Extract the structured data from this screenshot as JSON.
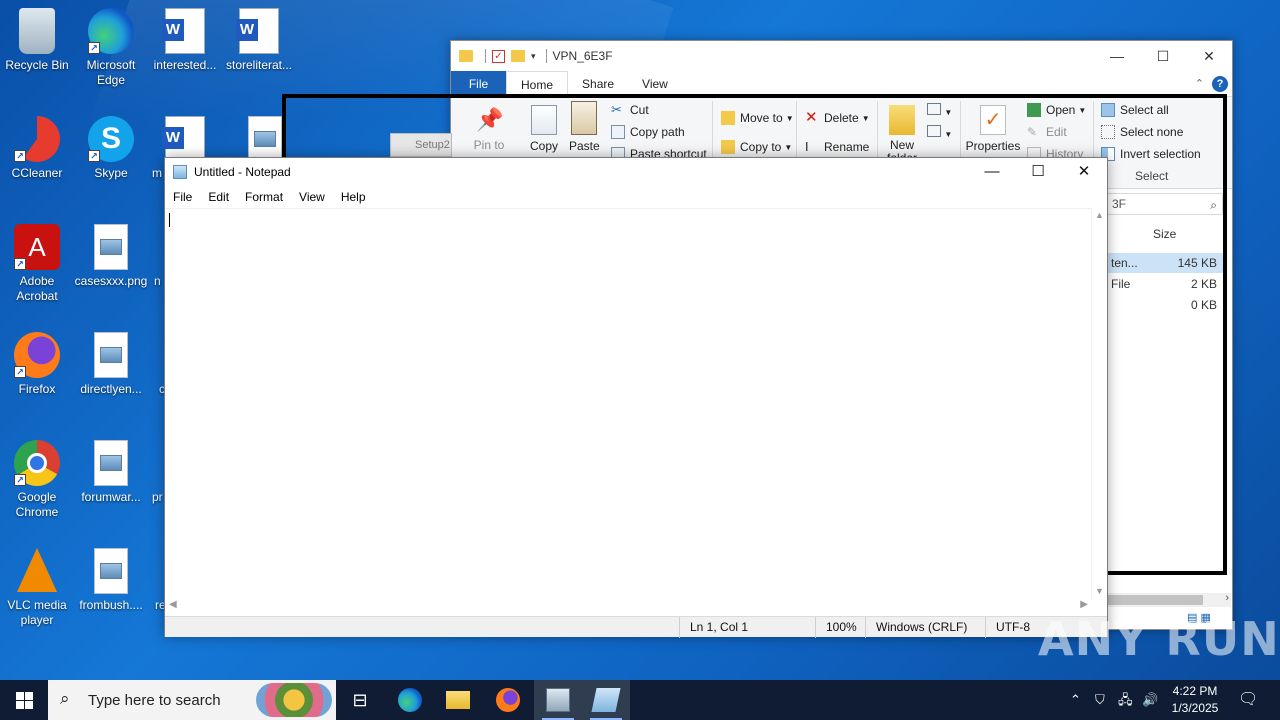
{
  "desktop": {
    "icons": [
      {
        "label": "Recycle Bin",
        "kind": "bin"
      },
      {
        "label": "Microsoft Edge",
        "kind": "edge"
      },
      {
        "label": "interested...",
        "kind": "word"
      },
      {
        "label": "storeliterat...",
        "kind": "word"
      },
      {
        "label": "CCleaner",
        "kind": "ccleaner"
      },
      {
        "label": "Skype",
        "kind": "skype"
      },
      {
        "label": "m",
        "kind": "word"
      },
      {
        "label": "Adobe Acrobat",
        "kind": "acrobat"
      },
      {
        "label": "casesxxx.png",
        "kind": "image"
      },
      {
        "label": "n",
        "kind": "partial"
      },
      {
        "label": "Firefox",
        "kind": "firefox"
      },
      {
        "label": "directlyen...",
        "kind": "image"
      },
      {
        "label": "c",
        "kind": "partial"
      },
      {
        "label": "Google Chrome",
        "kind": "chrome"
      },
      {
        "label": "forumwar...",
        "kind": "image"
      },
      {
        "label": "pr",
        "kind": "partial"
      },
      {
        "label": "VLC media player",
        "kind": "vlc"
      },
      {
        "label": "frombush....",
        "kind": "image"
      },
      {
        "label": "re",
        "kind": "partial"
      }
    ]
  },
  "explorer": {
    "title": "VPN_6E3F",
    "tabs": [
      "File",
      "Home",
      "Share",
      "View"
    ],
    "ribbon": {
      "pin": "Pin to Quick access",
      "copy": "Copy",
      "paste": "Paste",
      "cut": "Cut",
      "copy_path": "Copy path",
      "paste_shortcut": "Paste shortcut",
      "move_to": "Move to",
      "copy_to": "Copy to",
      "delete": "Delete",
      "rename": "Rename",
      "new_folder": "New folder",
      "properties": "Properties",
      "open": "Open",
      "edit": "Edit",
      "history": "History",
      "select_all": "Select all",
      "select_none": "Select none",
      "invert_selection": "Invert selection",
      "select_group": "Select"
    },
    "search_fragment": "3F",
    "column_size": "Size",
    "rows": [
      {
        "name": "ten...",
        "size": "145 KB",
        "selected": true
      },
      {
        "name": "File",
        "size": "2 KB",
        "selected": false
      },
      {
        "name": "",
        "size": "0 KB",
        "selected": false
      }
    ]
  },
  "setup_item": "Setup2",
  "notepad": {
    "title": "Untitled - Notepad",
    "menu": [
      "File",
      "Edit",
      "Format",
      "View",
      "Help"
    ],
    "content": "",
    "status": {
      "position": "Ln 1, Col 1",
      "zoom": "100%",
      "line_ending": "Windows (CRLF)",
      "encoding": "UTF-8"
    }
  },
  "watermark": "ANY RUN",
  "taskbar": {
    "search_placeholder": "Type here to search",
    "time": "4:22 PM",
    "date": "1/3/2025"
  },
  "colors": {
    "desktop_bg": "#0f62c0",
    "taskbar_bg": "#0f1c33",
    "accent": "#1a63b8",
    "overlay_border": "#000000"
  }
}
